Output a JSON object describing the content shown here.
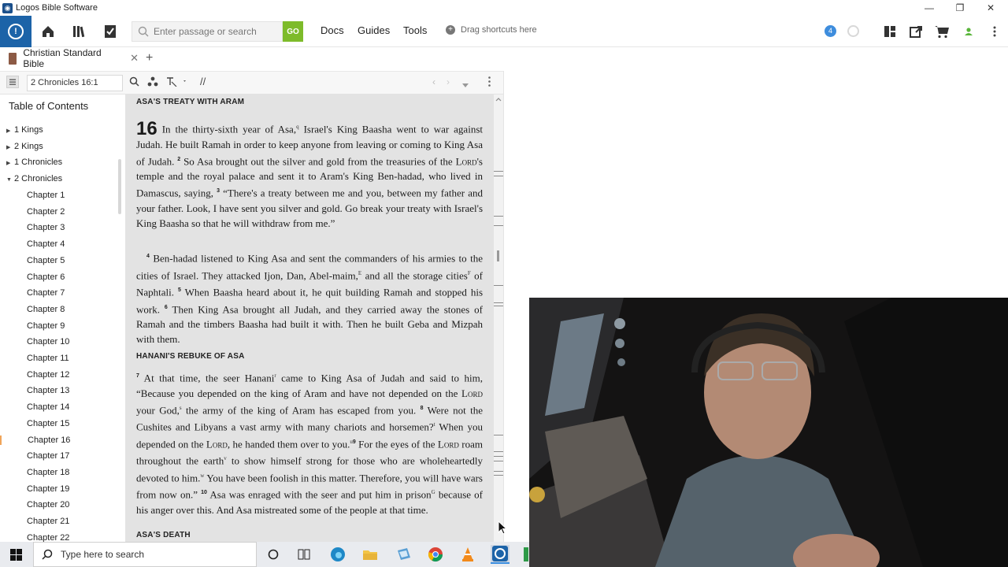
{
  "window": {
    "title": "Logos Bible Software",
    "controls": [
      "—",
      "❐",
      "✕"
    ]
  },
  "toolbar": {
    "search_placeholder": "Enter passage or search",
    "go_label": "GO",
    "menu": [
      "Docs",
      "Guides",
      "Tools"
    ],
    "drag_hint": "Drag shortcuts here",
    "notification_count": "4"
  },
  "doc_tab": {
    "label": "Christian Standard Bible",
    "close": "✕",
    "add": "+"
  },
  "panel": {
    "reference": "2 Chronicles 16:1",
    "parallel_icon": "//"
  },
  "toc": {
    "title": "Table of Contents",
    "books": [
      {
        "label": "1 Kings",
        "expanded": false
      },
      {
        "label": "2 Kings",
        "expanded": false
      },
      {
        "label": "1 Chronicles",
        "expanded": false
      },
      {
        "label": "2 Chronicles",
        "expanded": true
      }
    ],
    "chapters": [
      "Chapter 1",
      "Chapter 2",
      "Chapter 3",
      "Chapter 4",
      "Chapter 5",
      "Chapter 6",
      "Chapter 7",
      "Chapter 8",
      "Chapter 9",
      "Chapter 10",
      "Chapter 11",
      "Chapter 12",
      "Chapter 13",
      "Chapter 14",
      "Chapter 15",
      "Chapter 16",
      "Chapter 17",
      "Chapter 18",
      "Chapter 19",
      "Chapter 20",
      "Chapter 21",
      "Chapter 22"
    ],
    "selected_chapter": "Chapter 16"
  },
  "reader": {
    "heading1": "ASA'S TREATY WITH ARAM",
    "chapter_number": "16",
    "heading2": "HANANI'S REBUKE OF ASA",
    "heading3": "ASA'S DEATH",
    "p1": {
      "t1": "In the thirty-sixth year of Asa,",
      "fn1": "q",
      "t2": " Israel's King Baasha went to war against Judah. He built Ramah in order to keep anyone from leaving or coming to King Asa of Judah. ",
      "v2": "2",
      "t3": " So Asa brought out the silver and gold from the treasuries of the ",
      "lord": "Lord",
      "t4": "'s temple and the royal palace and sent it to Aram's King Ben-hadad, who lived in Damascus, saying, ",
      "v3": "3",
      "t5": " “There's a treaty between me and you, between my father and your father. Look, I have sent you silver and gold. Go break your treaty with Israel's King Baasha so that he will withdraw from me.”"
    },
    "p2": {
      "v4": "4",
      "t1": " Ben-hadad listened to King Asa and sent the commanders of his armies to the cities of Israel. They attacked Ijon, Dan, Abel-maim,",
      "fn1": "E",
      "t2": " and all the storage cities",
      "fn2": "F",
      "t3": " of Naphtali. ",
      "v5": "5",
      "t4": " When Baasha heard about it, he quit building Ramah and stopped his work. ",
      "v6": "6",
      "t5": " Then King Asa brought all Judah, and they carried away the stones of Ramah and the timbers Baasha had built it with. Then he built Geba and Mizpah with them."
    },
    "p3": {
      "v7": "7",
      "t1": " At that time, the seer Hanani",
      "fn1": "r",
      "t2": " came to King Asa of Judah and said to him, “Because you depended on the king of Aram and have not depended on the ",
      "lord1": "Lord",
      "t3": " your God,",
      "fn2": "s",
      "t4": " the army of the king of Aram has escaped from you. ",
      "v8": "8",
      "t5": " Were not the Cushites and Libyans a vast army with many chariots and horsemen?",
      "fn3": "t",
      "t6": " When you depended on the ",
      "lord2": "Lord",
      "t7": ", he handed them over to you.",
      "fn4": "u",
      "v9": "9",
      "t8": " For the eyes of the ",
      "lord3": "Lord",
      "t9": " roam throughout the earth",
      "fn5": "v",
      "t10": " to show himself strong for those who are wholeheartedly devoted to him.",
      "fn6": "w",
      "t11": " You have been foolish in this matter. Therefore, you will have wars from now on.” ",
      "v10": "10",
      "t12": " Asa was enraged with the seer and put him in prison",
      "fn7": "G",
      "t13": " because of his anger over this. And Asa mistreated some of the people at that time."
    }
  },
  "taskbar": {
    "search_text": "Type here to search"
  },
  "colors": {
    "logos_blue": "#1c63a8",
    "go_green": "#7dbb2a",
    "reader_bg": "#e3e3e3",
    "selection_accent": "#f0a55a"
  }
}
